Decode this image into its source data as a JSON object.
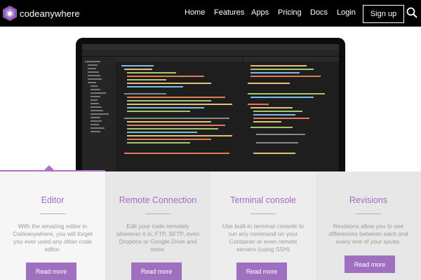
{
  "brand": {
    "name": "codeanywhere",
    "color": "#a070c0"
  },
  "nav": {
    "links": [
      "Home",
      "Features",
      "Apps",
      "Pricing",
      "Docs",
      "Login"
    ],
    "signup": "Sign up",
    "search_icon": "search-icon"
  },
  "hero": {
    "image": "laptop-editor-screenshot"
  },
  "features": [
    {
      "title": "Editor",
      "desc": "With the amazing editor in Codeanywhere, you will forget you ever used any other code editor.",
      "button": "Read more"
    },
    {
      "title": "Remote Connection",
      "desc": "Edit your code remotely wherever it is; FTP, SFTP, even Dropbox or Google Drive and more.",
      "button": "Read more"
    },
    {
      "title": "Terminal console",
      "desc": "Use built-in terminal console to run any command on your Container or even remote servers (using SSH)",
      "button": "Read more"
    },
    {
      "title": "Revisions",
      "desc": "Revisions allow you to see differences between each and every one of your saves.",
      "button": "Read more"
    }
  ]
}
